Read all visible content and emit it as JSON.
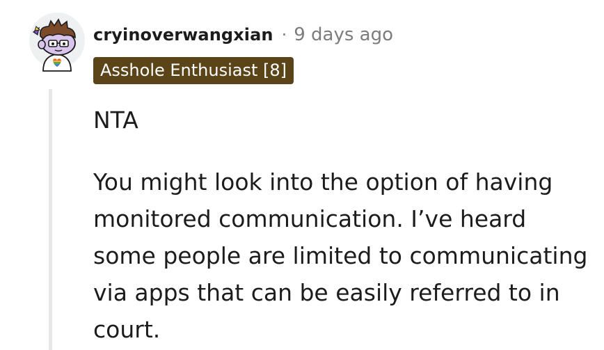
{
  "comment": {
    "author": "cryinoverwangxian",
    "separator": "·",
    "timestamp": "9 days ago",
    "flair": "Asshole Enthusiast [8]",
    "body": {
      "verdict": "NTA",
      "paragraph": "You might look into the option of having monitored communication. I’ve heard some people are limited to communicating via apps that can be easily referred to in court."
    }
  },
  "colors": {
    "flair_bg": "#5a4418",
    "flair_text": "#ffffff",
    "meta_gray": "#7c7c7c",
    "thread_line": "#e5e7e8",
    "text": "#1c1c1c"
  },
  "icons": {
    "avatar": "snoo-avatar-icon"
  }
}
